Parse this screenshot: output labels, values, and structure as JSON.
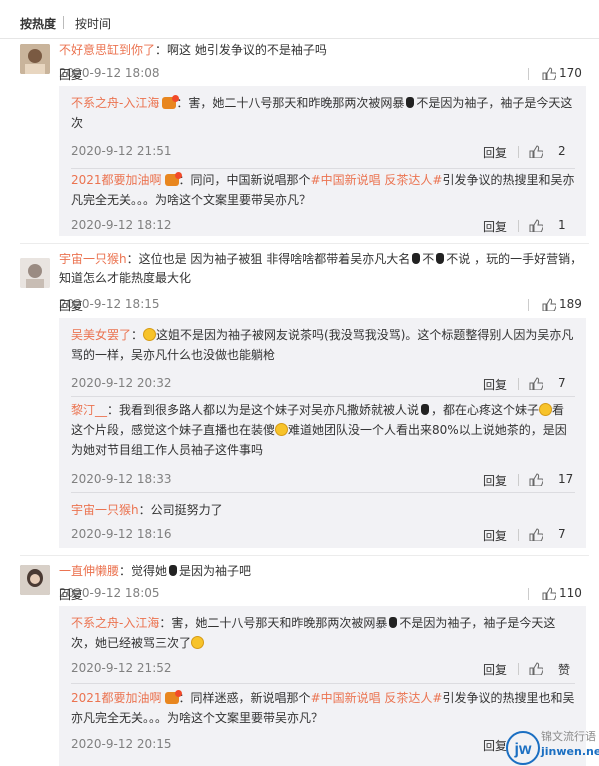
{
  "sort": {
    "hot": "按热度",
    "time": "按时间"
  },
  "comments": [
    {
      "user": "不好意思缸到你了",
      "text": "：啊这 她引发争议的不是袖子吗",
      "date": "2020-9-12 18:08",
      "reply_label": "回复",
      "likes": "170",
      "replies": [
        {
          "user": "不系之舟-入江海",
          "t1": "：害，她二十八号那天和昨晚那两次被网暴",
          "t2": "不是因为袖子，袖子是今天这次",
          "date": "2020-9-12 21:51",
          "reply_label": "回复",
          "likes": "2"
        },
        {
          "user": "2021都要加油啊",
          "t1": "：同问，中国新说唱那个",
          "tag": "#中国新说唱 反茶达人#",
          "t2": "引发争议的热搜里和吴亦凡完全无关。。。为啥这个文案里要带吴亦凡？",
          "date": "2020-9-12 18:12",
          "reply_label": "回复",
          "likes": "1"
        }
      ]
    },
    {
      "user": "宇宙一只猴h",
      "t1": "：这位也是 因为袖子被狙 非得啥啥都带着吴亦凡大名",
      "t2": "不",
      "t3": "不说 ，玩的一手好营销，知道怎么才能热度最大化",
      "date": "2020-9-12 18:15",
      "reply_label": "回复",
      "likes": "189",
      "replies": [
        {
          "user": "吴美女罢了",
          "t1": "：",
          "t2": "这姐不是因为袖子被网友说茶吗(我没骂我没骂)。这个标题整得别人因为吴亦凡骂的一样，吴亦凡什么也没做也能躺枪",
          "date": "2020-9-12 20:32",
          "reply_label": "回复",
          "likes": "7"
        },
        {
          "user": "黎汀__",
          "t1": "：我看到很多路人都以为是这个妹子对吴亦凡撒娇就被人说",
          "t2": "，都在心疼这个妹子",
          "t3": "看这个片段，感觉这个妹子直播也在装傻",
          "t4": "难道她团队没一个人看出来80%以上说她茶的，是因为她对节目组工作人员袖子这件事吗",
          "date": "2020-9-12 18:33",
          "reply_label": "回复",
          "likes": "17"
        },
        {
          "user": "宇宙一只猴h",
          "t1": "：公司挺努力了",
          "date": "2020-9-12 18:16",
          "reply_label": "回复",
          "likes": "7"
        }
      ]
    },
    {
      "user": "一直伸懒腰",
      "t1": "：觉得她",
      "t2": "是因为袖子吧",
      "date": "2020-9-12 18:05",
      "reply_label": "回复",
      "likes": "110",
      "replies": [
        {
          "user": "不系之舟-入江海",
          "t1": "：害，她二十八号那天和昨晚那两次被网暴",
          "t2": "不是因为袖子，袖子是今天这次，她已经被骂三次了",
          "date": "2020-9-12 21:52",
          "reply_label": "回复",
          "likes": "赞"
        },
        {
          "user": "2021都要加油啊",
          "t1": "：同样迷惑，新说唱那个",
          "tag": "#中国新说唱 反茶达人#",
          "t2": "引发争议的热搜里也和吴亦凡完全无关。。。为啥这个文案里要带吴亦凡？",
          "date": "2020-9-12 20:15",
          "reply_label": "回复",
          "likes": ""
        }
      ]
    }
  ],
  "watermark": {
    "brand": "锦文流行语",
    "domain": "jinwen.net",
    "logo": "jw"
  }
}
